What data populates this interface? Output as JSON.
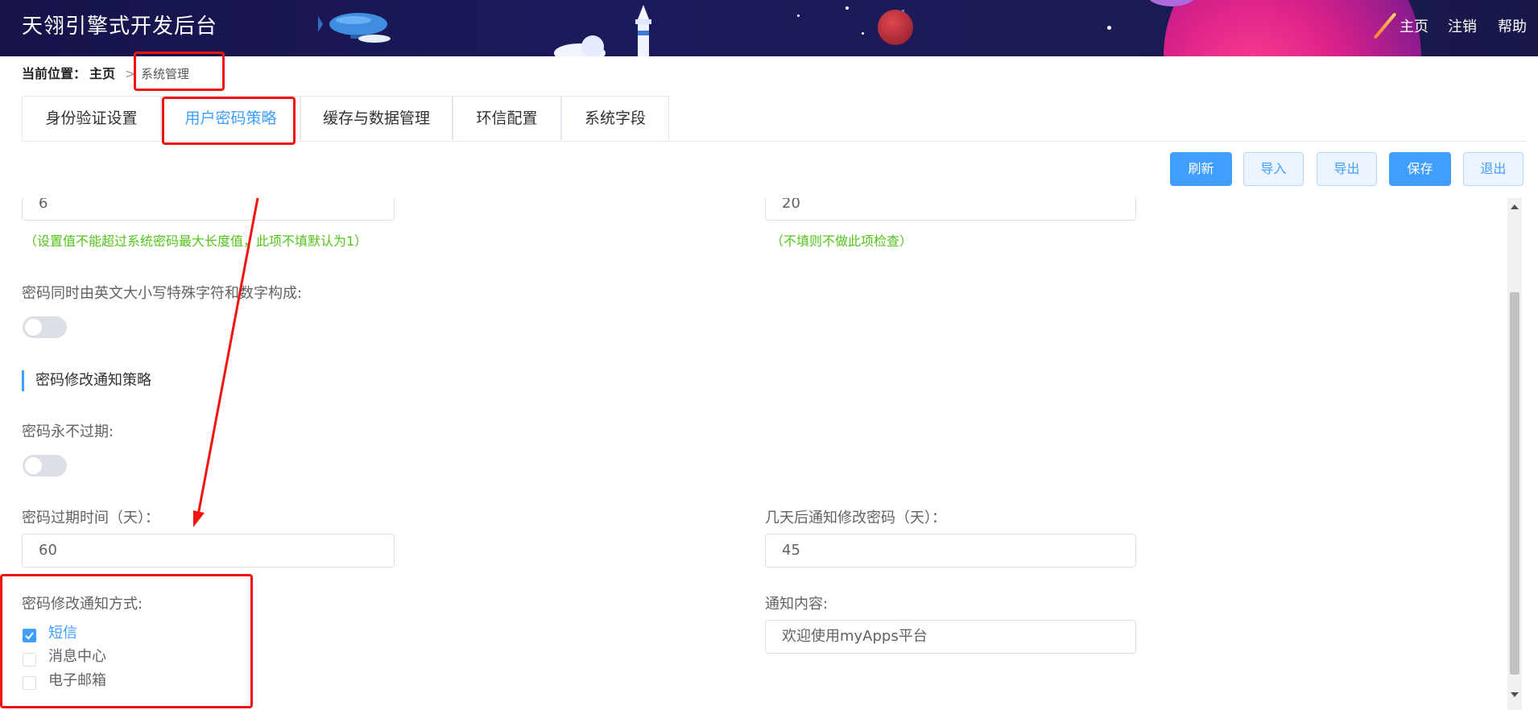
{
  "header": {
    "title": "天翎引擎式开发后台",
    "nav": [
      "主页",
      "注销",
      "帮助"
    ]
  },
  "breadcrumb": {
    "label": "当前位置：",
    "home": "主页",
    "separator": ">",
    "current": "系统管理"
  },
  "tabs": [
    {
      "label": "身份验证设置",
      "active": false
    },
    {
      "label": "用户密码策略",
      "active": true
    },
    {
      "label": "缓存与数据管理",
      "active": false
    },
    {
      "label": "环信配置",
      "active": false
    },
    {
      "label": "系统字段",
      "active": false
    }
  ],
  "toolbar": {
    "refresh": "刷新",
    "import": "导入",
    "export": "导出",
    "save": "保存",
    "exit": "退出"
  },
  "form": {
    "min_length_value": "6",
    "min_length_hint": "（设置值不能超过系统密码最大长度值，此项不填默认为1）",
    "max_length_value": "20",
    "max_length_hint": "（不填则不做此项检查）",
    "complexity_label": "密码同时由英文大小写特殊字符和数字构成:",
    "complexity_on": false,
    "section_title": "密码修改通知策略",
    "never_expire_label": "密码永不过期:",
    "never_expire_on": false,
    "expire_days_label": "密码过期时间（天）：",
    "expire_days_value": "60",
    "notify_days_label": "几天后通知修改密码（天）：",
    "notify_days_value": "45",
    "notify_method_label": "密码修改通知方式:",
    "notify_methods": [
      {
        "label": "短信",
        "checked": true
      },
      {
        "label": "消息中心",
        "checked": false
      },
      {
        "label": "电子邮箱",
        "checked": false
      }
    ],
    "notify_content_label": "通知内容:",
    "notify_content_value": "欢迎使用myApps平台"
  },
  "colors": {
    "header_bg": "#1c1a55",
    "accent": "#409eff",
    "hint": "#52c41a",
    "annotation": "#f0140f"
  }
}
